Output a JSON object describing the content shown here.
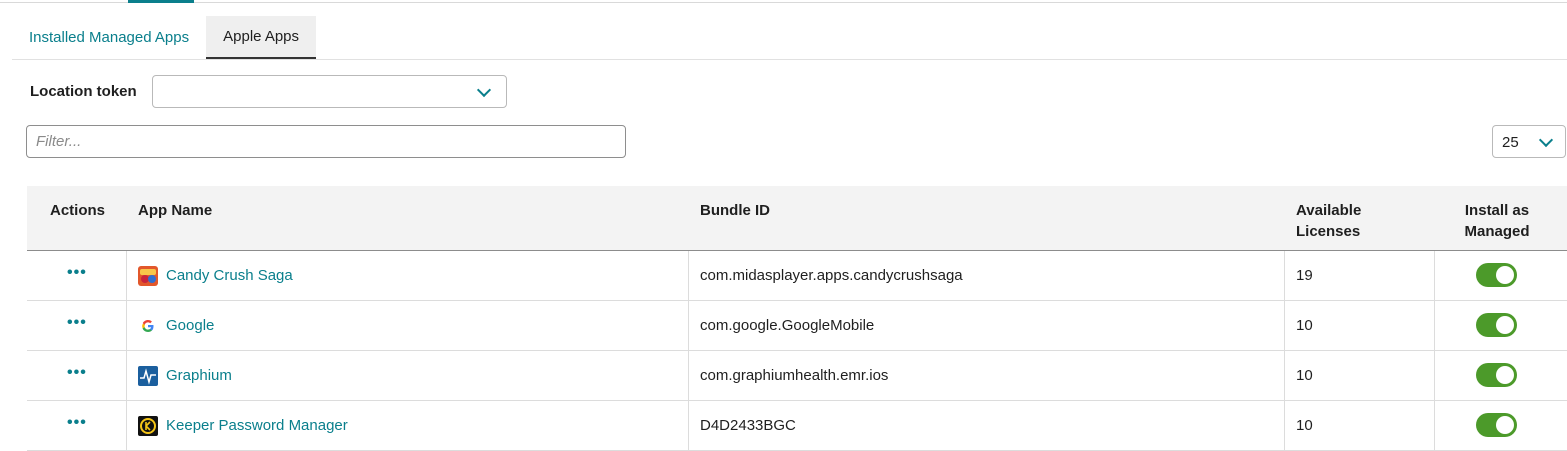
{
  "tabs": [
    {
      "label": "Installed Managed Apps",
      "active": false
    },
    {
      "label": "Apple Apps",
      "active": true
    }
  ],
  "location_token": {
    "label": "Location token",
    "value": ""
  },
  "filter": {
    "placeholder": "Filter...",
    "value": ""
  },
  "page_size": {
    "value": "25"
  },
  "table": {
    "headers": {
      "actions": "Actions",
      "app_name": "App Name",
      "bundle_id": "Bundle ID",
      "available_licenses": "Available Licenses",
      "install_as_managed": "Install as Managed"
    },
    "rows": [
      {
        "actions": "•••",
        "app_name": "Candy Crush Saga",
        "icon": "candy-crush-icon",
        "bundle_id": "com.midasplayer.apps.candycrushsaga",
        "available_licenses": "19",
        "install_as_managed": true
      },
      {
        "actions": "•••",
        "app_name": "Google",
        "icon": "google-icon",
        "bundle_id": "com.google.GoogleMobile",
        "available_licenses": "10",
        "install_as_managed": true
      },
      {
        "actions": "•••",
        "app_name": "Graphium",
        "icon": "graphium-icon",
        "bundle_id": "com.graphiumhealth.emr.ios",
        "available_licenses": "10",
        "install_as_managed": true
      },
      {
        "actions": "•••",
        "app_name": "Keeper Password Manager",
        "icon": "keeper-icon",
        "bundle_id": "D4D2433BGC",
        "available_licenses": "10",
        "install_as_managed": true
      }
    ]
  },
  "colors": {
    "accent": "#0a7f8c",
    "toggle_on": "#4c9a2a"
  }
}
